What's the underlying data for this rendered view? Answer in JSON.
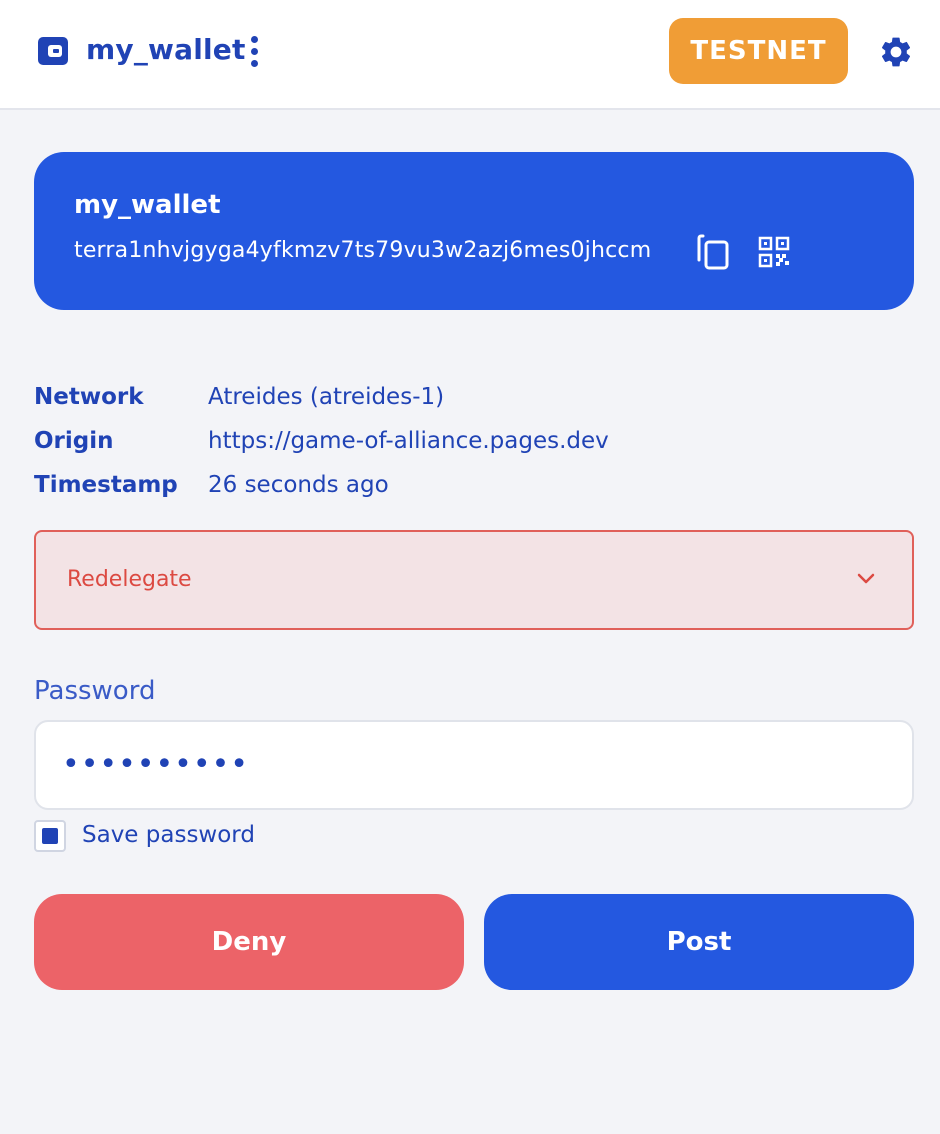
{
  "header": {
    "wallet_name": "my_wallet",
    "network_badge": "TESTNET",
    "icons": [
      "wallet-icon",
      "more-vertical-icon",
      "gear-icon"
    ]
  },
  "wallet_card": {
    "name": "my_wallet",
    "address": "terra1nhvjgyga4yfkmzv7ts79vu3w2azj6mes0jhccm",
    "icons": [
      "copy-icon",
      "qr-code-icon"
    ]
  },
  "details": [
    {
      "label": "Network",
      "value": "Atreides (atreides-1)"
    },
    {
      "label": "Origin",
      "value": "https://game-of-alliance.pages.dev"
    },
    {
      "label": "Timestamp",
      "value": "26 seconds ago"
    }
  ],
  "message": {
    "label": "Redelegate"
  },
  "password": {
    "label": "Password",
    "value": "••••••••••"
  },
  "save_password": {
    "label": "Save password",
    "checked": true
  },
  "actions": {
    "deny_label": "Deny",
    "post_label": "Post"
  },
  "colors": {
    "primary": "#2458e0",
    "text": "#2043b5",
    "testnet": "#f09d36",
    "deny": "#ec6368",
    "error": "#dc4a42",
    "background": "#f3f4f8"
  }
}
